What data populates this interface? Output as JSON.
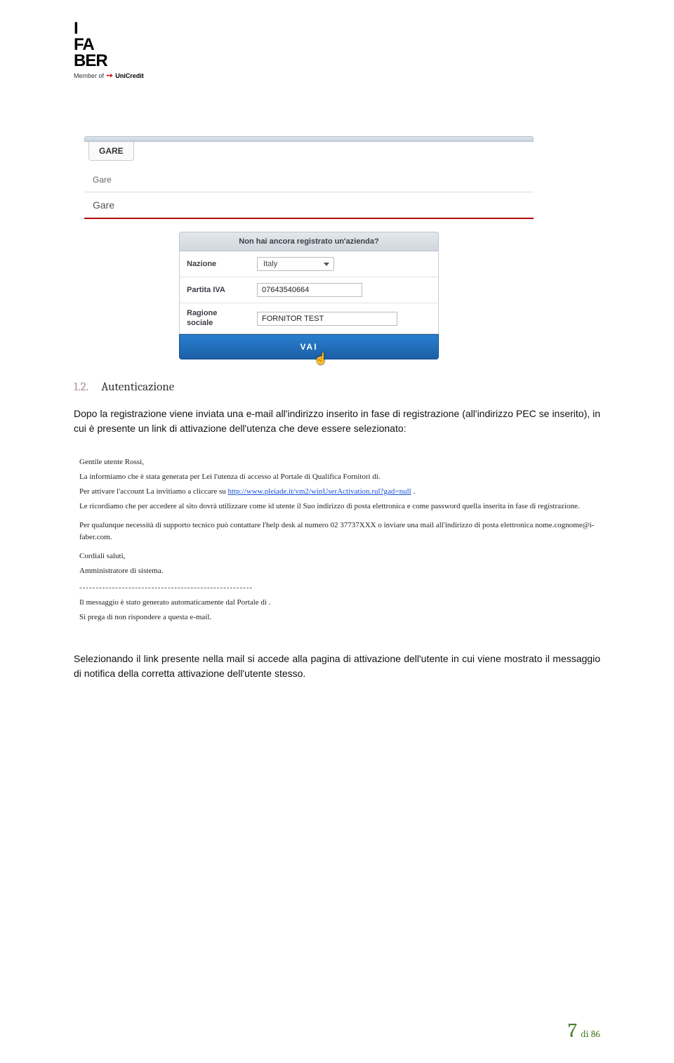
{
  "logo": {
    "l1": "I",
    "l2": "FA",
    "l3": "BER",
    "member_prefix": "Member of",
    "member_brand": "UniCredit"
  },
  "shot1": {
    "tab": "GARE",
    "row1": "Gare",
    "row2": "Gare",
    "panel_head": "Non hai ancora registrato un'azienda?",
    "fields": {
      "nazione_label": "Nazione",
      "nazione_value": "Italy",
      "piva_label": "Partita IVA",
      "piva_value": "07643540664",
      "ragione_label": "Ragione\nsociale",
      "ragione_value": "FORNITOR TEST"
    },
    "button": "VAI"
  },
  "heading": {
    "no": "1.2.",
    "title": "Autenticazione"
  },
  "para1": "Dopo la registrazione viene inviata una e-mail all'indirizzo inserito in fase di registrazione (all'indirizzo PEC se inserito), in cui è presente un link di attivazione dell'utenza che deve essere selezionato:",
  "email": {
    "greet": "Gentile utente Rossi,",
    "p1": "La informiamo che è stata generata per Lei l'utenza di accesso al Portale di Qualifica Fornitori di.",
    "p2a": "Per attivare l'account La invitiamo a cliccare su ",
    "p2link": "http://www.pleiade.it/vm2/winUserActivation.rul?gad=null",
    "p2b": " .",
    "p3": "Le ricordiamo che per accedere al sito dovrà utilizzare come id utente il Suo indirizzo di posta elettronica e come password quella inserita in fase di registrazione.",
    "p4": "Per qualunque necessità di supporto tecnico può contattare l'help desk al numero 02 37737XXX o inviare una mail all'indirizzo di posta elettronica nome.cognome@i-faber.com.",
    "sign1": "Cordiali saluti,",
    "sign2": "Amministratore di sistema.",
    "dots": "-----------------------------------------------------",
    "auto1": "Il messaggio è stato generato automaticamente dal Portale di .",
    "auto2": "Si prega di non rispondere a questa e-mail."
  },
  "para2": "Selezionando il link presente nella mail si accede alla pagina di attivazione dell'utente in cui viene mostrato il messaggio di notifica della corretta attivazione dell'utente stesso.",
  "page": {
    "num": "7",
    "of": "di 86"
  }
}
